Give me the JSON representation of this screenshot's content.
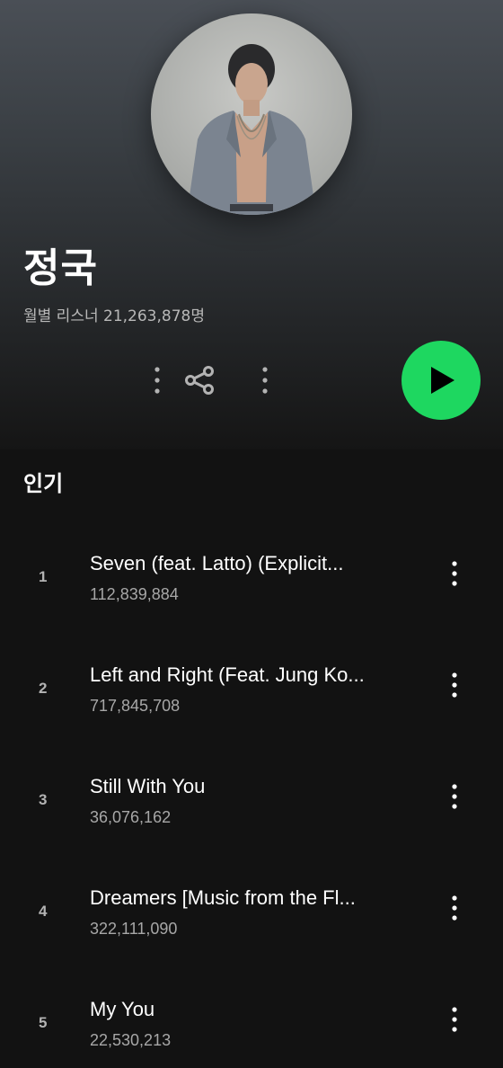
{
  "artist": {
    "name": "정국",
    "monthly_listeners": "월별 리스너 21,263,878명"
  },
  "actions": {
    "more_icon": "vertical-dots-icon",
    "share_icon": "share-icon",
    "play_icon": "play-icon",
    "accent_color": "#1ed760"
  },
  "popular": {
    "title": "인기",
    "tracks": [
      {
        "rank": "1",
        "title": "Seven (feat. Latto) (Explicit...",
        "plays": "112,839,884"
      },
      {
        "rank": "2",
        "title": "Left and Right (Feat. Jung Ko...",
        "plays": "717,845,708"
      },
      {
        "rank": "3",
        "title": "Still With You",
        "plays": "36,076,162"
      },
      {
        "rank": "4",
        "title": "Dreamers [Music from the Fl...",
        "plays": "322,111,090"
      },
      {
        "rank": "5",
        "title": "My You",
        "plays": "22,530,213"
      }
    ]
  }
}
